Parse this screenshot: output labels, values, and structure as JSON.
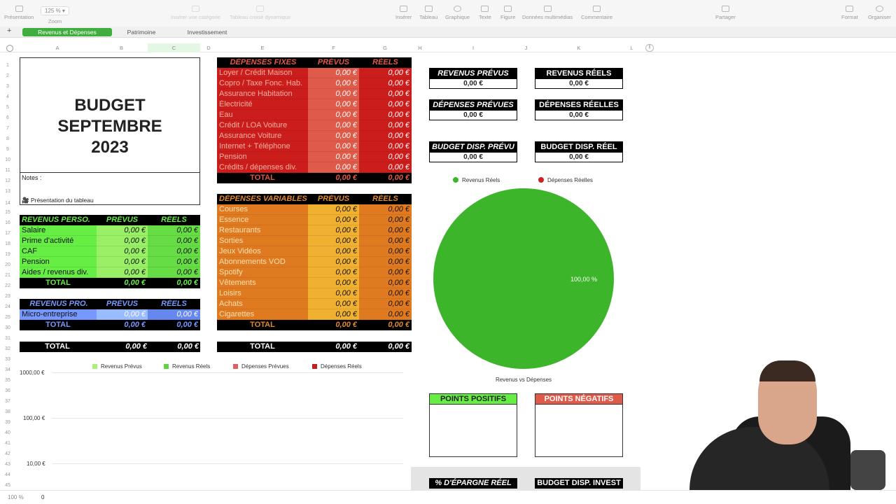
{
  "toolbar": {
    "zoom_value": "125 %",
    "items": [
      "Présentation",
      "Zoom",
      "Insérer une catégorie",
      "Tableau croisé dynamique",
      "Insérer",
      "Tableau",
      "Graphique",
      "Texte",
      "Figure",
      "Données multimédias",
      "Commentaire",
      "Partager",
      "Format",
      "Organiser"
    ]
  },
  "tabs": [
    "Revenus et Dépenses",
    "Patrimoine",
    "Investissement"
  ],
  "columns": [
    "A",
    "B",
    "C",
    "D",
    "E",
    "F",
    "G",
    "H",
    "I",
    "J",
    "K",
    "L"
  ],
  "rows": [
    "1",
    "2",
    "3",
    "4",
    "5",
    "6",
    "7",
    "8",
    "9",
    "10",
    "11",
    "12",
    "13",
    "14",
    "15",
    "16",
    "17",
    "18",
    "19",
    "20",
    "21",
    "22",
    "23",
    "24",
    "25",
    "30",
    "31",
    "32",
    "33",
    "34",
    "35",
    "36",
    "37",
    "38",
    "39",
    "40",
    "41",
    "42",
    "43",
    "44",
    "45"
  ],
  "title": {
    "line1": "BUDGET SEPTEMBRE",
    "line2": "2023"
  },
  "notes": {
    "label": "Notes :",
    "link": "Présentation du tableau"
  },
  "headers": {
    "prevus": "PRÉVUS",
    "reels": "RÉELS",
    "total": "TOTAL"
  },
  "zero": "0,00 €",
  "revenus_perso": {
    "title": "REVENUS PERSO.",
    "items": [
      "Salaire",
      "Prime d'activité",
      "CAF",
      "Pension",
      "Aides / revenus div."
    ]
  },
  "revenus_pro": {
    "title": "REVENUS PRO.",
    "items": [
      "Micro-entreprise"
    ]
  },
  "depenses_fixes": {
    "title": "DÉPENSES FIXES",
    "items": [
      "Loyer / Crédit Maison",
      "Copro / Taxe Fonc. Hab.",
      "Assurance Habitation",
      "Électricité",
      "Eau",
      "Crédit / LOA Voiture",
      "Assurance Voiture",
      "Internet + Téléphone",
      "Pension",
      "Crédits / dépenses div."
    ]
  },
  "depenses_variables": {
    "title": "DÉPENSES VARIABLES",
    "items": [
      "Courses",
      "Essence",
      "Restaurants",
      "Sorties",
      "Jeux Vidéos",
      "Abonnements VOD",
      "Spotify",
      "Vêtements",
      "Loisirs",
      "Achats",
      "Cigarettes"
    ]
  },
  "kpis": [
    {
      "label": "REVENUS PRÉVUS",
      "value": "0,00 €"
    },
    {
      "label": "REVENUS RÉELS",
      "value": "0,00 €"
    },
    {
      "label": "DÉPENSES PRÉVUES",
      "value": "0,00 €"
    },
    {
      "label": "DÉPENSES RÉELLES",
      "value": "0,00 €"
    },
    {
      "label": "BUDGET DISP. PRÉVU",
      "value": "0,00 €"
    },
    {
      "label": "BUDGET DISP. RÉEL",
      "value": "0,00 €"
    }
  ],
  "bottom_boxes": {
    "pos": "POINTS POSITIFS",
    "neg": "POINTS NÉGATIFS",
    "epargne": "% D'ÉPARGNE RÉEL",
    "invest": "BUDGET DISP. INVEST"
  },
  "colors": {
    "green": "#66ee44",
    "green_dark": "#44cc22",
    "blue": "#7799ff",
    "red": "#cc1d1d",
    "red_light": "#e05a4a",
    "orange": "#e07a20",
    "orange_light": "#f0b030",
    "accent_tab": "#3fae3f"
  },
  "chart_data": [
    {
      "type": "pie",
      "title": "Revenus vs Dépenses",
      "legend": [
        "Revenus Réels",
        "Dépenses Réelles"
      ],
      "slices": [
        {
          "name": "Revenus Réels",
          "value": 100,
          "color": "#3db52b"
        },
        {
          "name": "Dépenses Réelles",
          "value": 0,
          "color": "#cc2222"
        }
      ],
      "slice_label": "100,00 %",
      "legend_position": "top"
    },
    {
      "type": "bar",
      "title": "",
      "legend": [
        "Revenus Prévus",
        "Revenus Réels",
        "Dépenses Prévues",
        "Dépenses Réels"
      ],
      "legend_colors": [
        "#a8f07a",
        "#5ad63a",
        "#e06060",
        "#c02020"
      ],
      "yscale": "log",
      "yticks": [
        "1000,00 €",
        "100,00 €",
        "10,00 €"
      ],
      "legend_position": "top"
    }
  ],
  "statusbar": {
    "zoom": "100 %",
    "value": "0"
  }
}
